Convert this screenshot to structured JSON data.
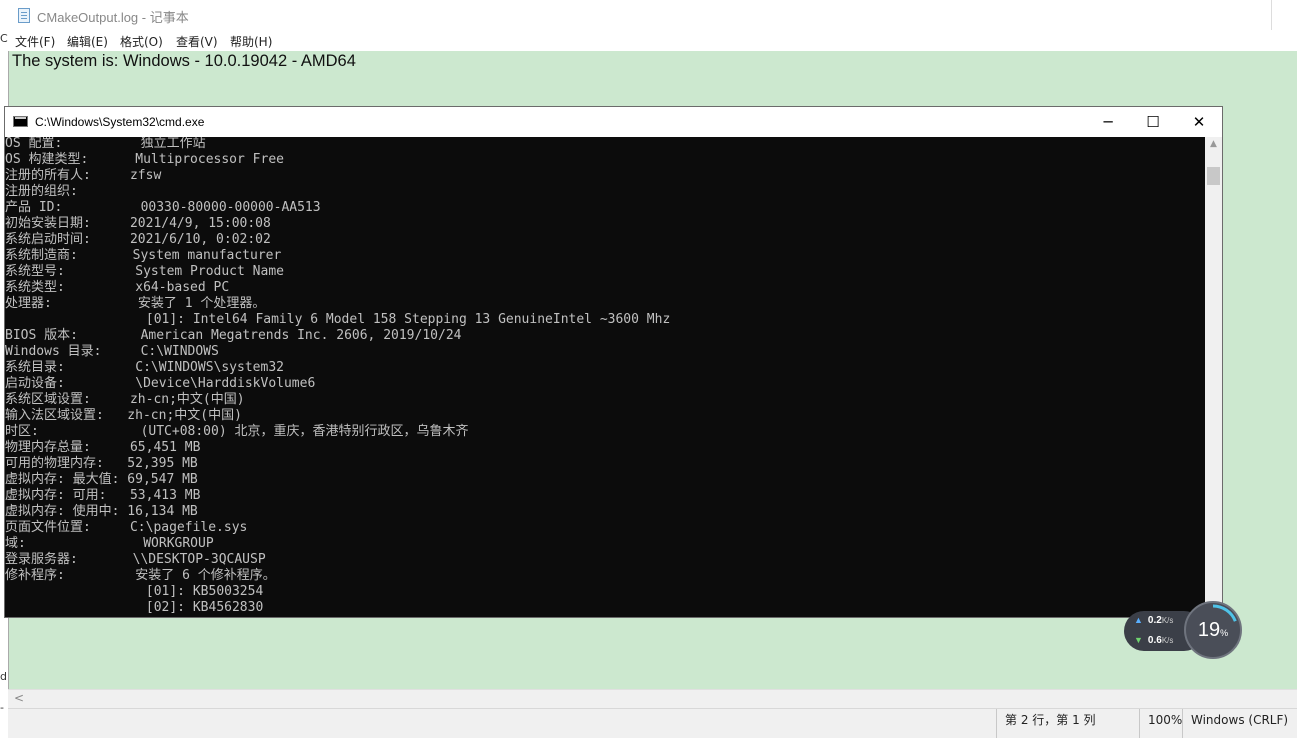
{
  "notepad": {
    "title": "CMakeOutput.log - 记事本",
    "menu": [
      "文件(F)",
      "编辑(E)",
      "格式(O)",
      "查看(V)",
      "帮助(H)"
    ],
    "content_line": "The system is: Windows - 10.0.19042 - AMD64",
    "status": {
      "position": "第 2 行，第 1 列",
      "zoom": "100%",
      "encoding": "Windows (CRLF)"
    },
    "hscroll_left_arrow": "<"
  },
  "left_edge_glyphs": [
    "C",
    "d",
    "-"
  ],
  "cmd": {
    "title": "C:\\Windows\\System32\\cmd.exe",
    "controls": {
      "minimize": "─",
      "maximize": "☐",
      "close": "✕"
    },
    "lines": [
      "OS 配置:          独立工作站",
      "OS 构建类型:      Multiprocessor Free",
      "注册的所有人:     zfsw",
      "注册的组织:",
      "产品 ID:          00330-80000-00000-AA513",
      "初始安装日期:     2021/4/9, 15:00:08",
      "系统启动时间:     2021/6/10, 0:02:02",
      "系统制造商:       System manufacturer",
      "系统型号:         System Product Name",
      "系统类型:         x64-based PC",
      "处理器:           安装了 1 个处理器。",
      "                  [01]: Intel64 Family 6 Model 158 Stepping 13 GenuineIntel ~3600 Mhz",
      "BIOS 版本:        American Megatrends Inc. 2606, 2019/10/24",
      "Windows 目录:     C:\\WINDOWS",
      "系统目录:         C:\\WINDOWS\\system32",
      "启动设备:         \\Device\\HarddiskVolume6",
      "系统区域设置:     zh-cn;中文(中国)",
      "输入法区域设置:   zh-cn;中文(中国)",
      "时区:             (UTC+08:00) 北京，重庆，香港特别行政区，乌鲁木齐",
      "物理内存总量:     65,451 MB",
      "可用的物理内存:   52,395 MB",
      "虚拟内存: 最大值: 69,547 MB",
      "虚拟内存: 可用:   53,413 MB",
      "虚拟内存: 使用中: 16,134 MB",
      "页面文件位置:     C:\\pagefile.sys",
      "域:               WORKGROUP",
      "登录服务器:       \\\\DESKTOP-3QCAUSP",
      "修补程序:         安装了 6 个修补程序。",
      "                  [01]: KB5003254",
      "                  [02]: KB4562830"
    ]
  },
  "network_widget": {
    "upload": "0.2",
    "upload_unit": "K/s",
    "download": "0.6",
    "download_unit": "K/s",
    "percent": "19",
    "percent_sign": "%",
    "percent_value": 0.19,
    "colors": {
      "ring": "#4fc3e8",
      "pill": "#3b3f48"
    }
  }
}
